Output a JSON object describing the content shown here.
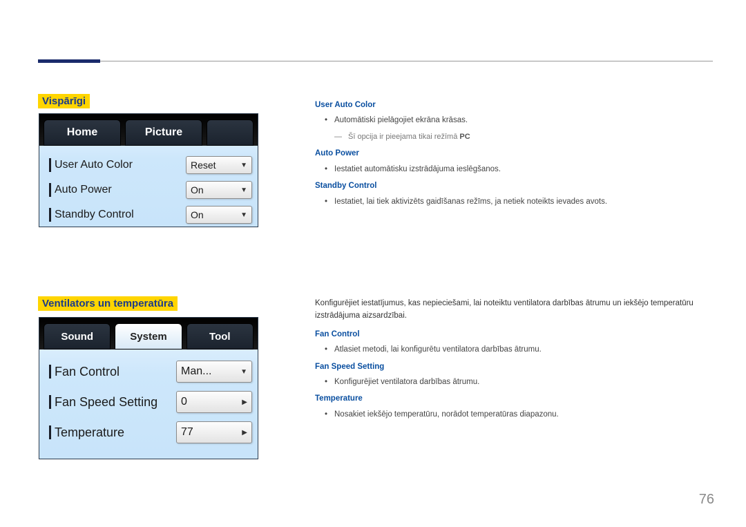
{
  "page_number": "76",
  "section1": {
    "title": "Vispārīgi",
    "tabs": {
      "home": "Home",
      "picture": "Picture"
    },
    "rows": {
      "user_auto_color": {
        "label": "User Auto Color",
        "value": "Reset"
      },
      "auto_power": {
        "label": "Auto Power",
        "value": "On"
      },
      "standby_control": {
        "label": "Standby Control",
        "value": "On"
      }
    },
    "desc": {
      "user_auto_color": {
        "term": "User Auto Color",
        "bullet": "Automātiski pielāgojiet ekrāna krāsas.",
        "note_prefix": "Šī opcija ir pieejama tikai režīmā ",
        "note_bold": "PC"
      },
      "auto_power": {
        "term": "Auto Power",
        "bullet": "Iestatiet automātisku izstrādājuma ieslēgšanos."
      },
      "standby_control": {
        "term": "Standby Control",
        "bullet": "Iestatiet, lai tiek aktivizēts gaidīšanas režīms, ja netiek noteikts ievades avots."
      }
    }
  },
  "section2": {
    "title": "Ventilators un temperatūra",
    "tabs": {
      "sound": "Sound",
      "system": "System",
      "tool": "Tool"
    },
    "rows": {
      "fan_control": {
        "label": "Fan Control",
        "value": "Man..."
      },
      "fan_speed_setting": {
        "label": "Fan Speed Setting",
        "value": "0"
      },
      "temperature": {
        "label": "Temperature",
        "value": "77"
      }
    },
    "intro": "Konfigurējiet iestatījumus, kas nepieciešami, lai noteiktu ventilatora darbības ātrumu un iekšējo temperatūru izstrādājuma aizsardzībai.",
    "desc": {
      "fan_control": {
        "term": "Fan Control",
        "bullet": "Atlasiet metodi, lai konfigurētu ventilatora darbības ātrumu."
      },
      "fan_speed_setting": {
        "term": "Fan Speed Setting",
        "bullet": "Konfigurējiet ventilatora darbības ātrumu."
      },
      "temperature": {
        "term": "Temperature",
        "bullet": "Nosakiet iekšējo temperatūru, norādot temperatūras diapazonu."
      }
    }
  }
}
